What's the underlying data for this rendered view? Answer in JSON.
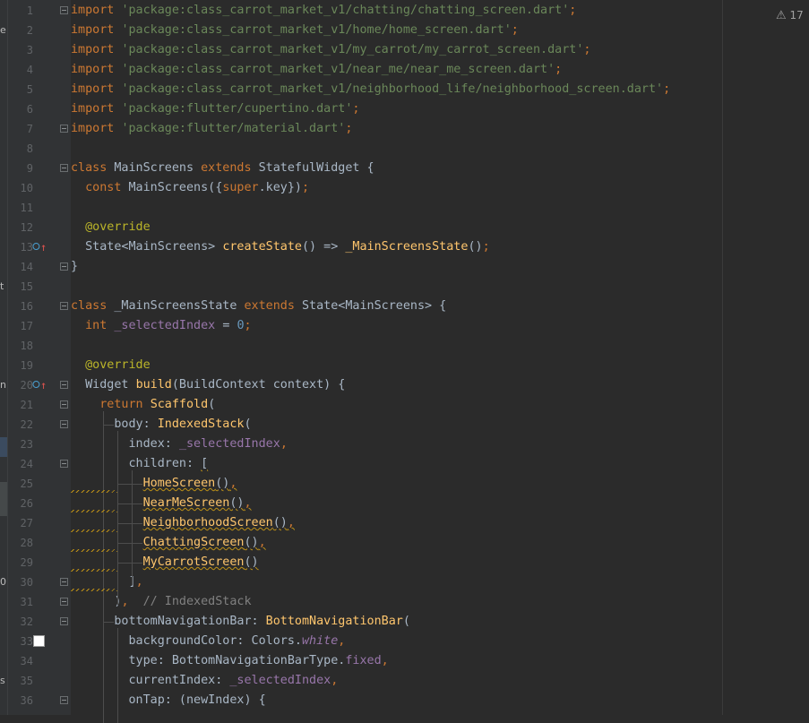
{
  "editor": {
    "lines": [
      {
        "n": "1",
        "tokens": [
          [
            "kw",
            "import "
          ],
          [
            "str",
            "'package:class_carrot_market_v1/chatting/chatting_screen.dart'"
          ],
          [
            "punc",
            ";"
          ]
        ]
      },
      {
        "n": "2",
        "tokens": [
          [
            "kw",
            "import "
          ],
          [
            "str",
            "'package:class_carrot_market_v1/home/home_screen.dart'"
          ],
          [
            "punc",
            ";"
          ]
        ]
      },
      {
        "n": "3",
        "tokens": [
          [
            "kw",
            "import "
          ],
          [
            "str",
            "'package:class_carrot_market_v1/my_carrot/my_carrot_screen.dart'"
          ],
          [
            "punc",
            ";"
          ]
        ]
      },
      {
        "n": "4",
        "tokens": [
          [
            "kw",
            "import "
          ],
          [
            "str",
            "'package:class_carrot_market_v1/near_me/near_me_screen.dart'"
          ],
          [
            "punc",
            ";"
          ]
        ]
      },
      {
        "n": "5",
        "tokens": [
          [
            "kw",
            "import "
          ],
          [
            "str",
            "'package:class_carrot_market_v1/neighborhood_life/neighborhood_screen.dart'"
          ],
          [
            "punc",
            ";"
          ]
        ]
      },
      {
        "n": "6",
        "tokens": [
          [
            "kw",
            "import "
          ],
          [
            "str",
            "'package:flutter/cupertino.dart'"
          ],
          [
            "punc",
            ";"
          ]
        ]
      },
      {
        "n": "7",
        "tokens": [
          [
            "kw",
            "import "
          ],
          [
            "str",
            "'package:flutter/material.dart'"
          ],
          [
            "punc",
            ";"
          ]
        ]
      },
      {
        "n": "8",
        "tokens": []
      },
      {
        "n": "9",
        "tokens": [
          [
            "kw",
            "class "
          ],
          [
            "cls",
            "MainScreens "
          ],
          [
            "kw",
            "extends "
          ],
          [
            "cls",
            "StatefulWidget {"
          ]
        ]
      },
      {
        "n": "10",
        "tokens": [
          [
            "cls",
            "  "
          ],
          [
            "kw",
            "const "
          ],
          [
            "cls",
            "MainScreens({"
          ],
          [
            "kw",
            "super"
          ],
          [
            "cls",
            ".key})"
          ],
          [
            "punc",
            ";"
          ]
        ]
      },
      {
        "n": "11",
        "tokens": []
      },
      {
        "n": "12",
        "tokens": [
          [
            "cls",
            "  "
          ],
          [
            "ann",
            "@override"
          ]
        ]
      },
      {
        "n": "13",
        "tokens": [
          [
            "cls",
            "  State<MainScreens> "
          ],
          [
            "fn",
            "createState"
          ],
          [
            "cls",
            "() => "
          ],
          [
            "fn",
            "_MainScreensState"
          ],
          [
            "cls",
            "()"
          ],
          [
            "punc",
            ";"
          ]
        ]
      },
      {
        "n": "14",
        "tokens": [
          [
            "cls",
            "}"
          ]
        ]
      },
      {
        "n": "15",
        "tokens": []
      },
      {
        "n": "16",
        "tokens": [
          [
            "kw",
            "class "
          ],
          [
            "cls",
            "_MainScreensState "
          ],
          [
            "kw",
            "extends "
          ],
          [
            "cls",
            "State<MainScreens> {"
          ]
        ]
      },
      {
        "n": "17",
        "tokens": [
          [
            "cls",
            "  "
          ],
          [
            "kw",
            "int "
          ],
          [
            "field",
            "_selectedIndex "
          ],
          [
            "cls",
            "= "
          ],
          [
            "num",
            "0"
          ],
          [
            "punc",
            ";"
          ]
        ]
      },
      {
        "n": "18",
        "tokens": []
      },
      {
        "n": "19",
        "tokens": [
          [
            "cls",
            "  "
          ],
          [
            "ann",
            "@override"
          ]
        ]
      },
      {
        "n": "20",
        "tokens": [
          [
            "cls",
            "  Widget "
          ],
          [
            "fn",
            "build"
          ],
          [
            "cls",
            "(BuildContext context) {"
          ]
        ]
      },
      {
        "n": "21",
        "tokens": [
          [
            "cls",
            "    "
          ],
          [
            "kw",
            "return "
          ],
          [
            "fn",
            "Scaffold"
          ],
          [
            "cls",
            "("
          ]
        ]
      },
      {
        "n": "22",
        "tokens": [
          [
            "cls",
            "      body: "
          ],
          [
            "fn",
            "IndexedStack"
          ],
          [
            "cls",
            "("
          ]
        ]
      },
      {
        "n": "23",
        "tokens": [
          [
            "cls",
            "        index: "
          ],
          [
            "field",
            "_selectedIndex"
          ],
          [
            "punc",
            ","
          ]
        ]
      },
      {
        "n": "24",
        "tokens": [
          [
            "cls",
            "        children: "
          ],
          [
            "cls warn",
            "["
          ]
        ]
      },
      {
        "n": "25",
        "tokens": [
          [
            "cls",
            "          "
          ],
          [
            "fn warn",
            "HomeScreen"
          ],
          [
            "cls warn",
            "()"
          ],
          [
            "punc warn",
            ","
          ]
        ]
      },
      {
        "n": "26",
        "tokens": [
          [
            "cls",
            "          "
          ],
          [
            "fn warn",
            "NearMeScreen"
          ],
          [
            "cls warn",
            "()"
          ],
          [
            "punc warn",
            ","
          ]
        ]
      },
      {
        "n": "27",
        "tokens": [
          [
            "cls",
            "          "
          ],
          [
            "fn warn",
            "NeighborhoodScreen"
          ],
          [
            "cls warn",
            "()"
          ],
          [
            "punc warn",
            ","
          ]
        ]
      },
      {
        "n": "28",
        "tokens": [
          [
            "cls",
            "          "
          ],
          [
            "fn warn",
            "ChattingScreen"
          ],
          [
            "cls warn",
            "()"
          ],
          [
            "punc warn",
            ","
          ]
        ]
      },
      {
        "n": "29",
        "tokens": [
          [
            "cls",
            "          "
          ],
          [
            "fn warn",
            "MyCarrotScreen"
          ],
          [
            "cls warn",
            "()"
          ]
        ]
      },
      {
        "n": "30",
        "tokens": [
          [
            "cls",
            "        ]"
          ],
          [
            "punc",
            ","
          ]
        ]
      },
      {
        "n": "31",
        "tokens": [
          [
            "cls",
            "      )"
          ],
          [
            "punc",
            ","
          ],
          [
            "cls",
            "  "
          ],
          [
            "cmt",
            "// IndexedStack"
          ]
        ]
      },
      {
        "n": "32",
        "tokens": [
          [
            "cls",
            "      bottomNavigationBar: "
          ],
          [
            "fn",
            "BottomNavigationBar"
          ],
          [
            "cls",
            "("
          ]
        ]
      },
      {
        "n": "33",
        "tokens": [
          [
            "cls",
            "        backgroundColor: Colors."
          ],
          [
            "field ital",
            "white"
          ],
          [
            "punc",
            ","
          ]
        ]
      },
      {
        "n": "34",
        "tokens": [
          [
            "cls",
            "        type: BottomNavigationBarType."
          ],
          [
            "field",
            "fixed"
          ],
          [
            "punc",
            ","
          ]
        ]
      },
      {
        "n": "35",
        "tokens": [
          [
            "cls",
            "        currentIndex: "
          ],
          [
            "field",
            "_selectedIndex"
          ],
          [
            "punc",
            ","
          ]
        ]
      },
      {
        "n": "36",
        "tokens": [
          [
            "cls",
            "        onTap: (newIndex) {"
          ]
        ]
      }
    ]
  },
  "left_strip": {
    "chars": [
      {
        "ch": "e",
        "line": 2
      },
      {
        "ch": "t",
        "line": 15
      },
      {
        "ch": "n.",
        "line": 20
      },
      {
        "ch": "0",
        "line": 30
      },
      {
        "ch": "s",
        "line": 35
      }
    ]
  },
  "inspection_widget": {
    "icon": "warning-triangle-icon",
    "count": "17"
  },
  "colors": {
    "background": "#2b2b2b",
    "gutter": "#313335",
    "keyword": "#cc7832",
    "string": "#6a8759",
    "function": "#ffc66d",
    "annotation": "#bbb529",
    "field": "#9876aa",
    "number": "#6897bb",
    "comment": "#808080",
    "warning": "#be9117"
  }
}
